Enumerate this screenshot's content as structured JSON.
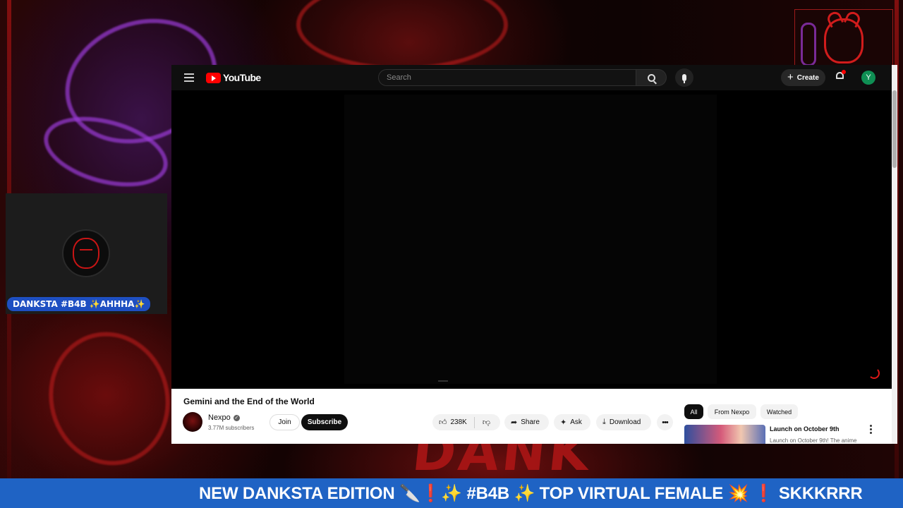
{
  "stream": {
    "webcam_name": "DANKSTA #B4B ✨AHHHA✨",
    "ticker": "NEW DANKSTA EDITION 🔪❗✨ #B4B ✨ TOP VIRTUAL FEMALE 💥 ❗ SKKKRRR",
    "background_word": "DANK",
    "accent_color": "#b01616"
  },
  "youtube": {
    "logo_text": "YouTube",
    "search_placeholder": "Search",
    "create_label": "Create",
    "account_initial": "Y",
    "video_title": "Gemini and the End of the World",
    "channel": {
      "name": "Nexpo",
      "subscribers": "3.77M subscribers"
    },
    "join_label": "Join",
    "subscribe_label": "Subscribe",
    "actions": {
      "likes": "238K",
      "share": "Share",
      "ask": "Ask",
      "download": "Download"
    },
    "chips": [
      "All",
      "From Nexpo",
      "Watched"
    ],
    "recommendation": {
      "title": "Launch on October 9th",
      "subtitle": "Launch on October 9th! The anime"
    }
  }
}
